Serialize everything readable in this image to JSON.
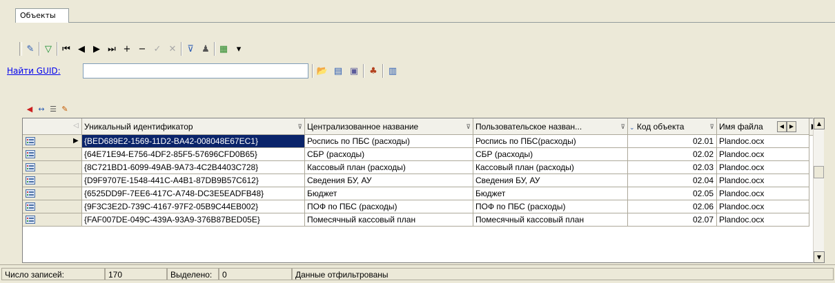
{
  "tabs": [
    {
      "label": "Объекты",
      "active": true
    }
  ],
  "toolbar1": [
    {
      "name": "edit-icon",
      "glyph": "✎",
      "color": "#2b5cb3"
    },
    {
      "name": "filter-green-icon",
      "glyph": "▽",
      "color": "#118a2a"
    },
    {
      "name": "first-record-icon",
      "glyph": "⏮",
      "color": "#000"
    },
    {
      "name": "prev-record-icon",
      "glyph": "◀",
      "color": "#000"
    },
    {
      "name": "next-record-icon",
      "glyph": "▶",
      "color": "#000"
    },
    {
      "name": "last-record-icon",
      "glyph": "⏭",
      "color": "#000"
    },
    {
      "name": "add-record-icon",
      "glyph": "+",
      "color": "#000"
    },
    {
      "name": "delete-record-icon",
      "glyph": "−",
      "color": "#000"
    },
    {
      "name": "post-edit-icon",
      "glyph": "✓",
      "color": "#a8a8a8"
    },
    {
      "name": "cancel-edit-icon",
      "glyph": "✕",
      "color": "#a8a8a8"
    },
    {
      "name": "filter-icon",
      "glyph": "⊽",
      "color": "#2b5cb3"
    },
    {
      "name": "find-binoculars-icon",
      "glyph": "♟",
      "color": "#555"
    },
    {
      "name": "export-icon",
      "glyph": "▦",
      "color": "#2a8a2a"
    },
    {
      "name": "dropdown-arrow-icon",
      "glyph": "▾",
      "color": "#000"
    }
  ],
  "find_guid": {
    "label": "Найти GUID:",
    "value": ""
  },
  "toolbar2": [
    {
      "name": "open-folder-icon",
      "glyph": "📂",
      "color": "#d89b1e"
    },
    {
      "name": "document-icon",
      "glyph": "▤",
      "color": "#2b5cb3"
    },
    {
      "name": "properties-icon",
      "glyph": "▣",
      "color": "#5a5a9a"
    },
    {
      "name": "user-action-icon",
      "glyph": "♣",
      "color": "#b3411e"
    },
    {
      "name": "grid-export-icon",
      "glyph": "▥",
      "color": "#2b5cb3"
    }
  ],
  "grid_toolbar": [
    {
      "name": "pin-red-icon",
      "glyph": "◀",
      "color": "#cc2020"
    },
    {
      "name": "swap-columns-icon",
      "glyph": "↔",
      "color": "#2b5cb3"
    },
    {
      "name": "list-settings-icon",
      "glyph": "☰",
      "color": "#555"
    },
    {
      "name": "clear-filter-icon",
      "glyph": "✎",
      "color": "#c45a00"
    }
  ],
  "columns": [
    {
      "label": "Уникальный идентификатор"
    },
    {
      "label": "Централизованное название"
    },
    {
      "label": "Пользовательское назван..."
    },
    {
      "label": "Код объекта"
    },
    {
      "label": "Имя файла"
    }
  ],
  "rows": [
    {
      "guid": "{BED689E2-1569-11D2-BA42-008048E67EC1}",
      "central": "Роспись по ПБС (расходы)",
      "user": "Роспись по ПБС(расходы)",
      "code": "02.01",
      "file": "Plandoc.ocx",
      "selected": true
    },
    {
      "guid": "{64E71E94-E756-4DF2-85F5-57696CFD0B65}",
      "central": "СБР (расходы)",
      "user": "СБР (расходы)",
      "code": "02.02",
      "file": "Plandoc.ocx"
    },
    {
      "guid": "{8C721BD1-6099-49AB-9A73-4C2B4403C728}",
      "central": "Кассовый план (расходы)",
      "user": "Кассовый план (расходы)",
      "code": "02.03",
      "file": "Plandoc.ocx"
    },
    {
      "guid": "{D9F9707E-1548-441C-A4B1-87DB9B57C612}",
      "central": "Сведения БУ, АУ",
      "user": "Сведения БУ, АУ",
      "code": "02.04",
      "file": "Plandoc.ocx"
    },
    {
      "guid": "{6525DD9F-7EE6-417C-A748-DC3E5EADFB48}",
      "central": "Бюджет",
      "user": "Бюджет",
      "code": "02.05",
      "file": "Plandoc.ocx"
    },
    {
      "guid": "{9F3C3E2D-739C-4167-97F2-05B9C44EB002}",
      "central": "ПОФ по ПБС (расходы)",
      "user": "ПОФ по ПБС (расходы)",
      "code": "02.06",
      "file": "Plandoc.ocx"
    },
    {
      "guid": "{FAF007DE-049C-439A-93A9-376B87BED05E}",
      "central": "Помесячный кассовый план",
      "user": "Помесячный кассовый план",
      "code": "02.07",
      "file": "Plandoc.ocx"
    }
  ],
  "status": {
    "records_label": "Число записей:",
    "records_value": "170",
    "selected_label": "Выделено:",
    "selected_value": "0",
    "filter_state": "Данные отфильтрованы"
  },
  "colors": {
    "selection": "#0a246a",
    "link": "#0000ee",
    "background": "#ece9d8"
  }
}
